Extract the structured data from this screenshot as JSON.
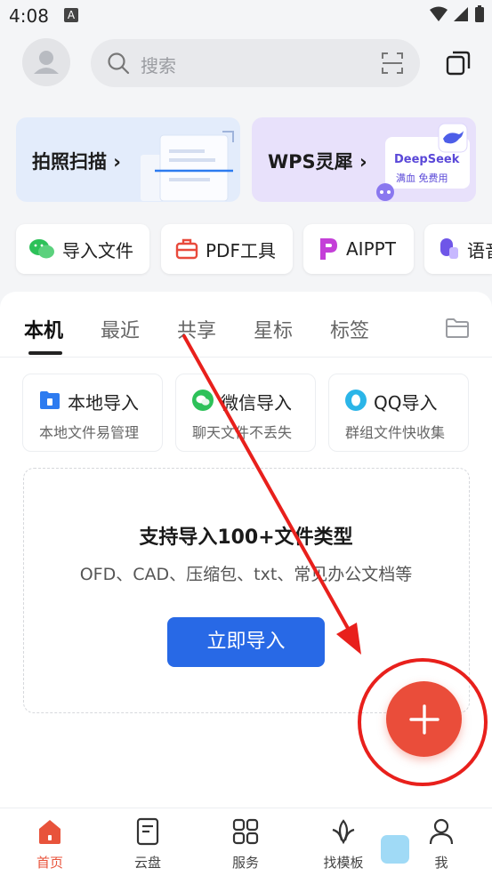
{
  "status_bar": {
    "time": "4:08",
    "notif_letter": "A"
  },
  "header": {
    "search_placeholder": "搜索"
  },
  "banners": [
    {
      "label": "拍照扫描 ›"
    },
    {
      "label": "WPS灵犀 ›",
      "badge_line1": "DeepSeek",
      "badge_line2": "满血 免费用"
    }
  ],
  "chips": [
    {
      "label": "导入文件"
    },
    {
      "label": "PDF工具"
    },
    {
      "label": "AIPPT"
    },
    {
      "label": "语音"
    }
  ],
  "tabs": [
    {
      "label": "本机"
    },
    {
      "label": "最近"
    },
    {
      "label": "共享"
    },
    {
      "label": "星标"
    },
    {
      "label": "标签"
    }
  ],
  "import_options": [
    {
      "title": "本地导入",
      "subtitle": "本地文件易管理"
    },
    {
      "title": "微信导入",
      "subtitle": "聊天文件不丢失"
    },
    {
      "title": "QQ导入",
      "subtitle": "群组文件快收集"
    }
  ],
  "empty_state": {
    "title": "支持导入100+文件类型",
    "subtitle": "OFD、CAD、压缩包、txt、常见办公文档等",
    "button": "立即导入"
  },
  "bottom_nav": [
    {
      "label": "首页"
    },
    {
      "label": "云盘"
    },
    {
      "label": "服务"
    },
    {
      "label": "找模板"
    },
    {
      "label": "我"
    }
  ],
  "colors": {
    "accent_blue": "#2869e6",
    "fab_red": "#ea4d3a",
    "annotation_red": "#e8201c",
    "nav_active": "#e8533b"
  }
}
